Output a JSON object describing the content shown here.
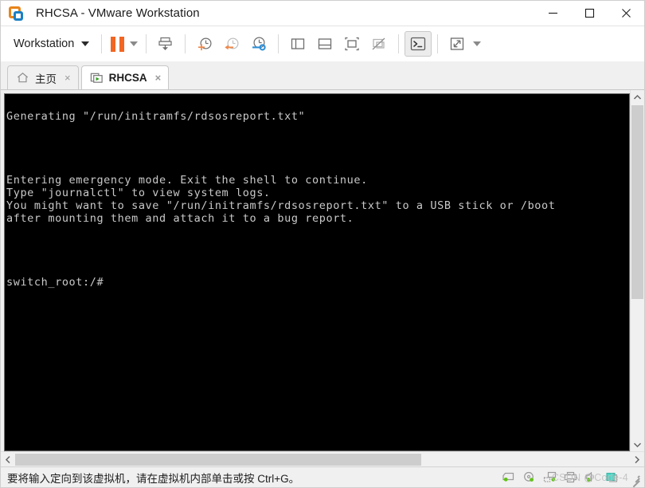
{
  "window": {
    "title": "RHCSA - VMware Workstation",
    "logo_icon": "vmware-logo-icon",
    "controls": {
      "minimize": "minimize-icon",
      "maximize": "maximize-icon",
      "close": "close-icon"
    }
  },
  "toolbar": {
    "menu_label": "Workstation",
    "menu_caret": "chevron-down-icon",
    "buttons": [
      {
        "name": "suspend-button",
        "icon": "pause-icon"
      },
      {
        "name": "power-dropdown",
        "icon": "chevron-down-icon"
      },
      {
        "name": "save-snapshot-button",
        "icon": "snapshot-save-icon"
      },
      {
        "name": "take-snapshot-button",
        "icon": "snapshot-add-clock-icon"
      },
      {
        "name": "revert-snapshot-button",
        "icon": "snapshot-revert-clock-icon"
      },
      {
        "name": "snapshot-manager-button",
        "icon": "snapshot-manager-clock-wrench-icon"
      },
      {
        "name": "show-library-button",
        "icon": "panel-left-icon"
      },
      {
        "name": "show-thumbnail-bar-button",
        "icon": "panel-bottom-icon"
      },
      {
        "name": "fit-guest-now-button",
        "icon": "fit-guest-icon"
      },
      {
        "name": "fit-window-now-button",
        "icon": "fit-window-disabled-icon"
      },
      {
        "name": "console-view-button",
        "icon": "console-prompt-icon",
        "pressed": true
      },
      {
        "name": "enter-fullscreen-button",
        "icon": "fullscreen-expand-icon"
      },
      {
        "name": "fullscreen-dropdown",
        "icon": "chevron-down-icon"
      }
    ]
  },
  "tabs": [
    {
      "label": "主页",
      "icon": "home-icon",
      "close": "×",
      "active": false
    },
    {
      "label": "RHCSA",
      "icon": "vm-running-icon",
      "close": "×",
      "active": true
    }
  ],
  "terminal": {
    "lines": [
      "Generating \"/run/initramfs/rdsosreport.txt\"",
      "",
      "",
      "Entering emergency mode. Exit the shell to continue.",
      "Type \"journalctl\" to view system logs.",
      "You might want to save \"/run/initramfs/rdsosreport.txt\" to a USB stick or /boot",
      "after mounting them and attach it to a bug report.",
      "",
      "",
      "switch_root:/# "
    ],
    "background_color": "#000000",
    "text_color": "#c9c9c9"
  },
  "scrollbars": {
    "vertical": {
      "up_arrow": "chevron-up-icon",
      "down_arrow": "chevron-down-icon"
    },
    "horizontal": {
      "left_arrow": "chevron-left-icon",
      "right_arrow": "chevron-right-icon"
    }
  },
  "statusbar": {
    "message": "要将输入定向到该虚拟机，请在虚拟机内部单击或按 Ctrl+G。",
    "devices": [
      {
        "name": "hard-disk-status-icon",
        "active": true
      },
      {
        "name": "cd-dvd-status-icon",
        "active": true
      },
      {
        "name": "network-adapter-status-icon",
        "active": true
      },
      {
        "name": "printer-status-icon",
        "active": false
      },
      {
        "name": "sound-card-status-icon",
        "active": true
      },
      {
        "name": "usb-device-status-icon",
        "active": false
      }
    ],
    "watermark": "CSDN @Code-4"
  },
  "colors": {
    "accent_orange": "#f26522",
    "accent_blue": "#1b7fc4",
    "chrome_gray": "#f0f0f0",
    "active_green": "#5bbf21"
  }
}
